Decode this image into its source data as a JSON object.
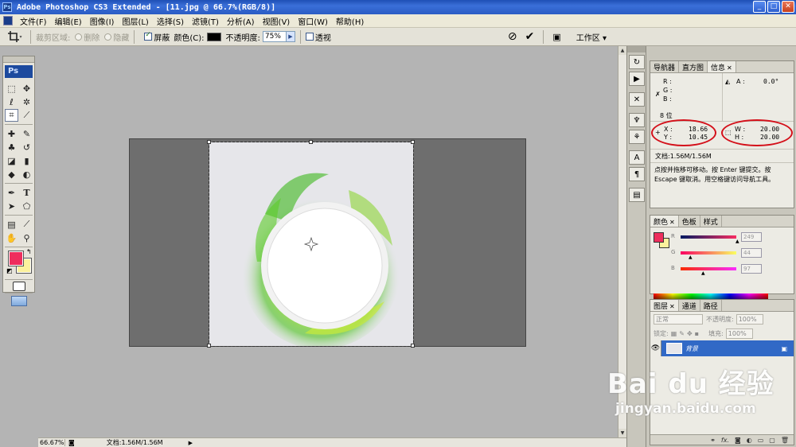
{
  "window": {
    "title": "Adobe Photoshop CS3 Extended - [11.jpg @ 66.7%(RGB/8)]",
    "app_icon_label": "Ps",
    "buttons": [
      "minimize-icon",
      "maximize-icon",
      "close-icon"
    ]
  },
  "menu": [
    "文件(F)",
    "编辑(E)",
    "图像(I)",
    "图层(L)",
    "选择(S)",
    "滤镜(T)",
    "分析(A)",
    "视图(V)",
    "窗口(W)",
    "帮助(H)"
  ],
  "options": {
    "crop_area_label": "裁剪区域:",
    "delete_label": "删除",
    "hide_label": "隐藏",
    "shield_label": "屏蔽",
    "shield_checked": true,
    "color_label": "颜色(C):",
    "shield_color": "#000000",
    "opacity_label": "不透明度:",
    "opacity_value": "75%",
    "perspective_label": "透视",
    "perspective_checked": false,
    "workspace_label": "工作区"
  },
  "toolbox": {
    "logo": "Ps",
    "foreground_color": "#ee2e5d",
    "background_color": "#fbf19d"
  },
  "status": {
    "zoom": "66.67%",
    "doc_info": "文档:1.56M/1.56M"
  },
  "info_panel": {
    "tabs": [
      "导航器",
      "直方图",
      "信息"
    ],
    "active_tab": "信息",
    "rgb_labels": [
      "R :",
      "G :",
      "B :"
    ],
    "angle_label": "A :",
    "angle_value": "0.0°",
    "bit_depth": "8 位",
    "x_label": "X :",
    "x_value": "18.66",
    "y_label": "Y :",
    "y_value": "10.45",
    "w_label": "W :",
    "w_value": "20.00",
    "h_label": "H :",
    "h_value": "20.00",
    "doc_size": "文档:1.56M/1.56M",
    "hint": "点按并拖移可移动。按 Enter 键提交。按 Escape 键取消。用空格键访问导航工具。"
  },
  "color_panel": {
    "tabs": [
      "颜色",
      "色板",
      "样式"
    ],
    "active_tab": "颜色",
    "channels": [
      {
        "label": "R",
        "value": "249"
      },
      {
        "label": "G",
        "value": "44"
      },
      {
        "label": "B",
        "value": "97"
      }
    ],
    "fg": "#ee2e5d",
    "bg": "#fbf19d"
  },
  "layers_panel": {
    "tabs": [
      "图层",
      "通道",
      "路径"
    ],
    "active_tab": "图层",
    "blend_mode": "正常",
    "opacity_label": "不透明度:",
    "opacity_value": "100%",
    "lock_label": "锁定:",
    "fill_label": "填充:",
    "fill_value": "100%",
    "layers": [
      {
        "name": "背景",
        "locked": true,
        "visible": true
      }
    ],
    "footer_icons": [
      "link-icon",
      "fx-icon",
      "mask-icon",
      "adjustment-icon",
      "group-icon",
      "new-layer-icon",
      "trash-icon"
    ]
  },
  "watermark": {
    "main": "Bai du 经验",
    "url": "jingyan.baidu.com"
  }
}
